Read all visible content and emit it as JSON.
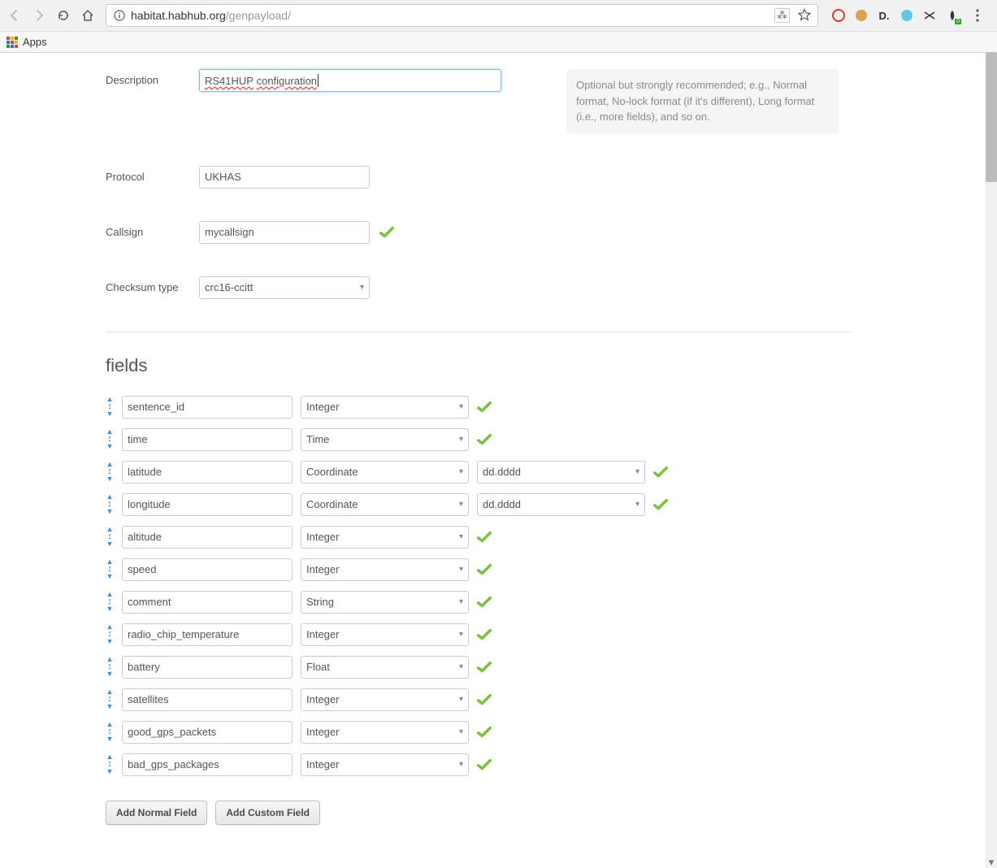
{
  "browser": {
    "url_host": "habitat.habhub.org",
    "url_path": "/genpayload/",
    "apps_label": "Apps"
  },
  "form": {
    "description": {
      "label": "Description",
      "value_part1": "RS41HUP",
      "value_part2": "configuration",
      "help": "Optional but strongly recommended; e.g., Normal format, No-lock format (if it's different), Long format (i.e., more fields), and so on."
    },
    "protocol": {
      "label": "Protocol",
      "value": "UKHAS"
    },
    "callsign": {
      "label": "Callsign",
      "value": "mycallsign"
    },
    "checksum": {
      "label": "Checksum type",
      "value": "crc16-ccitt"
    }
  },
  "fields_section": {
    "title": "fields",
    "add_normal": "Add Normal Field",
    "add_custom": "Add Custom Field"
  },
  "fields": [
    {
      "name": "sentence_id",
      "type": "Integer",
      "format": null
    },
    {
      "name": "time",
      "type": "Time",
      "format": null
    },
    {
      "name": "latitude",
      "type": "Coordinate",
      "format": "dd.dddd"
    },
    {
      "name": "longitude",
      "type": "Coordinate",
      "format": "dd.dddd"
    },
    {
      "name": "altitude",
      "type": "Integer",
      "format": null
    },
    {
      "name": "speed",
      "type": "Integer",
      "format": null
    },
    {
      "name": "comment",
      "type": "String",
      "format": null
    },
    {
      "name": "radio_chip_temperature",
      "type": "Integer",
      "format": null
    },
    {
      "name": "battery",
      "type": "Float",
      "format": null
    },
    {
      "name": "satellites",
      "type": "Integer",
      "format": null
    },
    {
      "name": "good_gps_packets",
      "type": "Integer",
      "format": null
    },
    {
      "name": "bad_gps_packages",
      "type": "Integer",
      "format": null
    }
  ]
}
